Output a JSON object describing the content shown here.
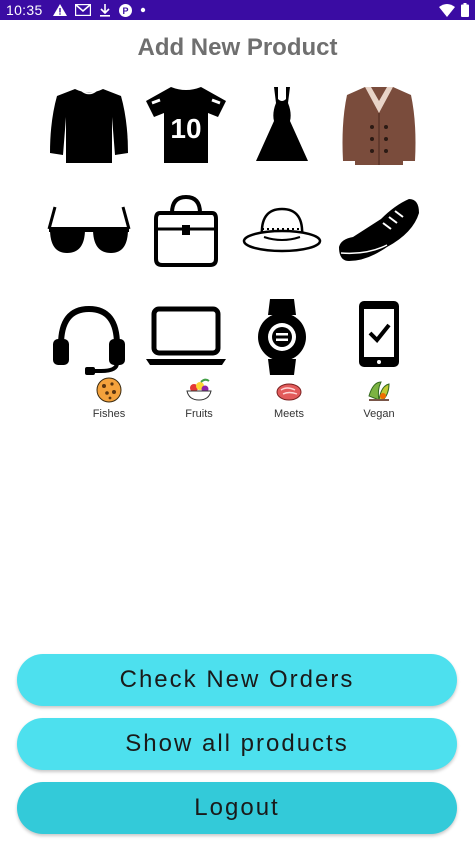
{
  "status_bar": {
    "time": "10:35",
    "icons": [
      "alert-icon",
      "gmail-icon",
      "download-icon",
      "app-icon",
      "dot-icon"
    ],
    "right_icons": [
      "wifi-icon",
      "battery-icon"
    ]
  },
  "page": {
    "title": "Add New Product"
  },
  "categories": [
    {
      "icon": "sweater-icon"
    },
    {
      "icon": "jersey-icon",
      "text": "10"
    },
    {
      "icon": "dress-icon"
    },
    {
      "icon": "coat-icon"
    },
    {
      "icon": "sunglasses-icon"
    },
    {
      "icon": "handbag-icon"
    },
    {
      "icon": "hat-icon"
    },
    {
      "icon": "sneaker-icon"
    },
    {
      "icon": "headset-icon"
    },
    {
      "icon": "laptop-icon"
    },
    {
      "icon": "smartwatch-icon"
    },
    {
      "icon": "smartphone-icon"
    }
  ],
  "food_categories": [
    {
      "label": "Fishes",
      "icon": "cookie-icon"
    },
    {
      "label": "Fruits",
      "icon": "fruit-bowl-icon"
    },
    {
      "label": "Meets",
      "icon": "meat-icon"
    },
    {
      "label": "Vegan",
      "icon": "vegetables-icon"
    }
  ],
  "buttons": {
    "check_orders": "Check New Orders",
    "show_products": "Show all products",
    "logout": "Logout"
  },
  "colors": {
    "status_bar": "#3a0ca3",
    "button": "#4de0ee",
    "logout_button": "#33cad9",
    "title": "#6f6f6f"
  }
}
